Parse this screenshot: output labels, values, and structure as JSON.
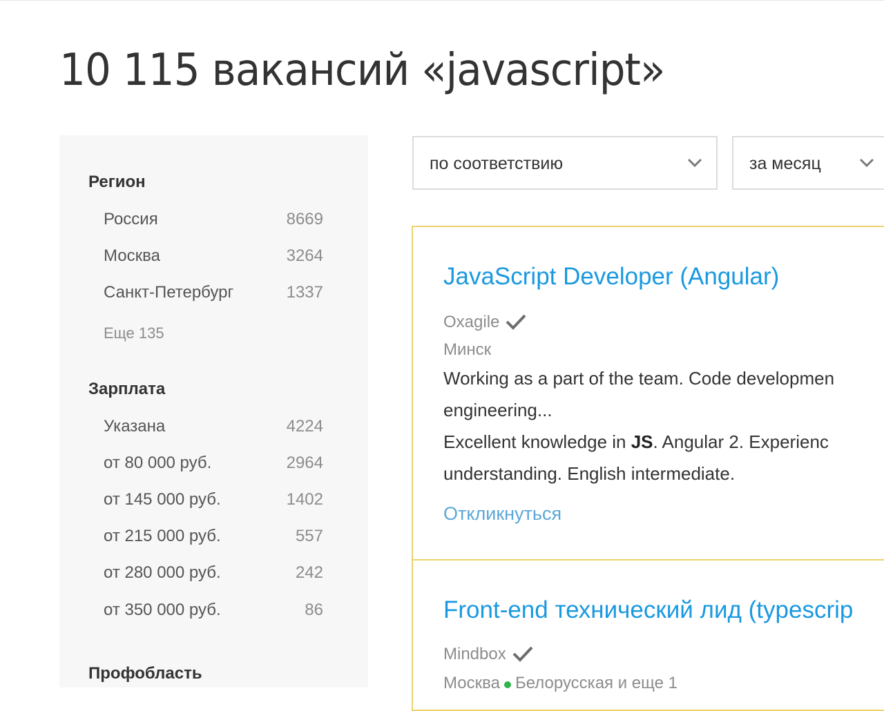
{
  "page_title": "10 115 вакансий «javascript»",
  "colors": {
    "accent_link": "#1a99e0",
    "respond_link": "#5aa7d9",
    "card_border": "#edd26b",
    "sidebar_bg": "#f7f7f7",
    "metro_green": "#2fb34a"
  },
  "sidebar": {
    "region": {
      "heading": "Регион",
      "items": [
        {
          "label": "Россия",
          "count": "8669"
        },
        {
          "label": "Москва",
          "count": "3264"
        },
        {
          "label": "Санкт-Петербург",
          "count": "1337"
        }
      ],
      "more": "Еще 135"
    },
    "salary": {
      "heading": "Зарплата",
      "items": [
        {
          "label": "Указана",
          "count": "4224"
        },
        {
          "label": "от 80 000 руб.",
          "count": "2964"
        },
        {
          "label": "от 145 000 руб.",
          "count": "1402"
        },
        {
          "label": "от 215 000 руб.",
          "count": "557"
        },
        {
          "label": "от 280 000 руб.",
          "count": "242"
        },
        {
          "label": "от 350 000 руб.",
          "count": "86"
        }
      ]
    },
    "profarea": {
      "heading": "Профобласть"
    }
  },
  "sort": {
    "order": {
      "value": "по соответствию",
      "icon": "chevron-down-icon"
    },
    "period": {
      "value": "за месяц",
      "icon": "chevron-down-icon"
    }
  },
  "vacancies": [
    {
      "title": "JavaScript Developer (Angular)",
      "company": "Oxagile",
      "verified_icon": "check-icon",
      "city": "Минск",
      "responsibility": "Working as a part of the team. Code developmen",
      "responsibility_cont": "engineering...",
      "requirement_pre": "Excellent knowledge in ",
      "requirement_bold": "JS",
      "requirement_post": ". Angular 2. Experienc",
      "requirement_cont": "understanding. English intermediate.",
      "respond": "Откликнуться"
    },
    {
      "title": "Front-end технический лид (typescrip",
      "company": "Mindbox",
      "verified_icon": "check-icon",
      "city": "Москва",
      "metro": "Белорусская и еще 1"
    }
  ]
}
